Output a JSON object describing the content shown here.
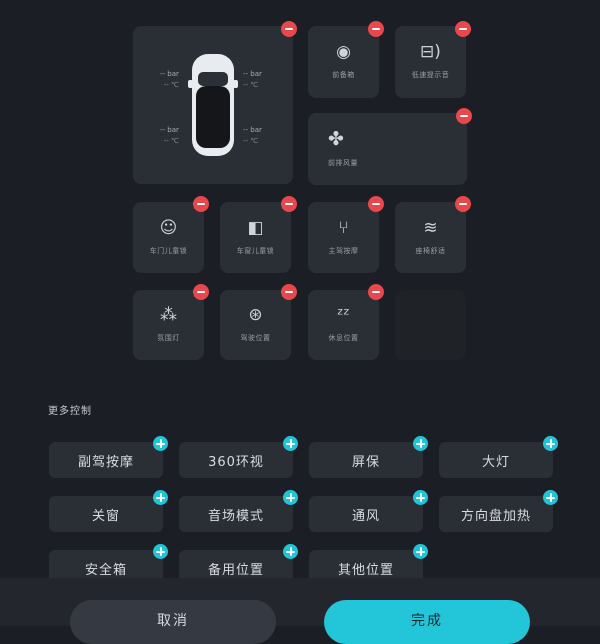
{
  "vehicle_tile": {
    "tires": {
      "front_left": {
        "pressure": "-- bar",
        "temp": "-- ℃"
      },
      "front_right": {
        "pressure": "-- bar",
        "temp": "-- ℃"
      },
      "rear_left": {
        "pressure": "-- bar",
        "temp": "-- ℃"
      },
      "rear_right": {
        "pressure": "-- bar",
        "temp": "-- ℃"
      }
    }
  },
  "tiles": [
    {
      "label": "前备箱",
      "icon": "frunk-icon"
    },
    {
      "label": "低速提示音",
      "icon": "car-sound-icon"
    },
    {
      "label": "前排风量",
      "icon": "fan-icon"
    },
    {
      "label": "车门儿童锁",
      "icon": "door-child-lock-icon"
    },
    {
      "label": "车窗儿童锁",
      "icon": "window-child-lock-icon"
    },
    {
      "label": "主驾按摩",
      "icon": "seat-massage-icon"
    },
    {
      "label": "座椅舒适",
      "icon": "seat-heat-icon"
    },
    {
      "label": "氛围灯",
      "icon": "ambient-light-icon"
    },
    {
      "label": "驾驶位置",
      "icon": "driving-position-icon"
    },
    {
      "label": "休息位置",
      "icon": "rest-position-icon"
    }
  ],
  "more_controls": {
    "title": "更多控制",
    "items": [
      "副驾按摩",
      "360环视",
      "屏保",
      "大灯",
      "关窗",
      "音场模式",
      "通风",
      "方向盘加热",
      "安全箱",
      "备用位置",
      "其他位置"
    ]
  },
  "buttons": {
    "cancel": "取消",
    "done": "完成"
  },
  "colors": {
    "remove": "#e8474c",
    "add": "#1fc4d9",
    "primary": "#22c6d8"
  }
}
